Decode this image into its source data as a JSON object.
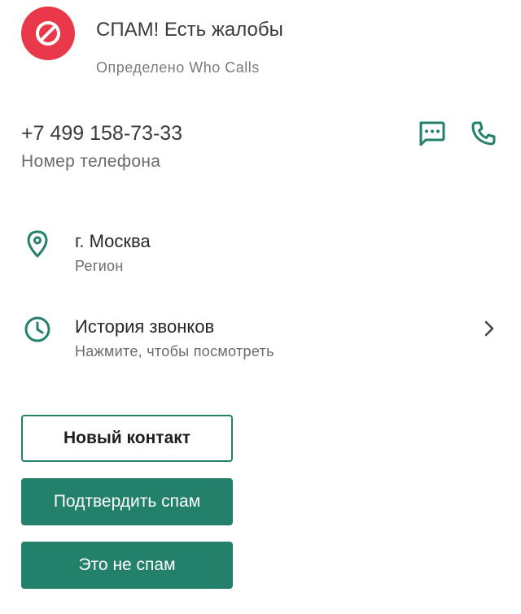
{
  "colors": {
    "accent": "#23806a",
    "spam_red": "#e8384a",
    "text_primary": "#262626",
    "text_secondary": "#6b6b6b"
  },
  "spam_banner": {
    "icon": "block-icon",
    "title": "СПАМ! Есть жалобы",
    "source": "Определено Who Calls"
  },
  "phone": {
    "number": "+7 499 158-73-33",
    "caption": "Номер телефона",
    "actions": [
      {
        "icon": "message-icon"
      },
      {
        "icon": "phone-icon"
      }
    ]
  },
  "region": {
    "icon": "location-pin-icon",
    "title": "г. Москва",
    "subtitle": "Регион"
  },
  "call_history": {
    "icon": "clock-icon",
    "title": "История звонков",
    "subtitle": "Нажмите, чтобы посмотреть",
    "trailing_icon": "chevron-right-icon"
  },
  "buttons": {
    "new_contact": "Новый контакт",
    "confirm_spam": "Подтвердить спам",
    "not_spam": "Это не спам"
  }
}
